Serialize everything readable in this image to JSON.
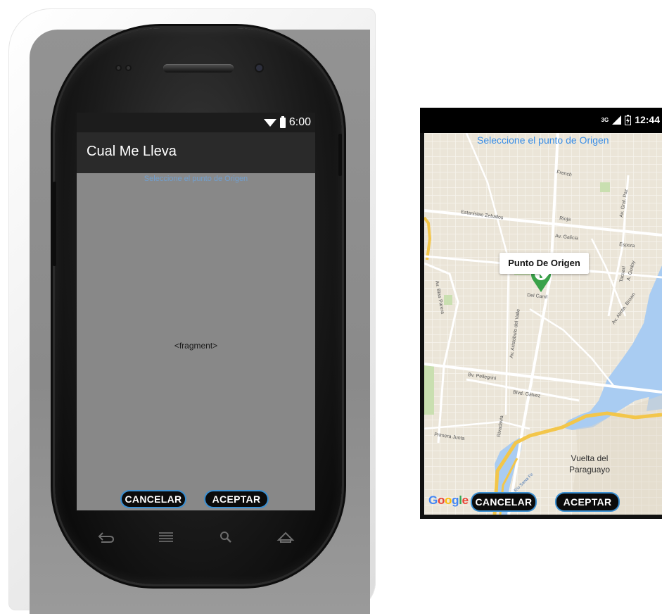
{
  "editor_preview": {
    "status_time": "6:00",
    "app_title": "Cual Me Lleva",
    "hint_text": "Seleccione el punto de Origen",
    "fragment_placeholder": "<fragment>",
    "cancel_label": "CANCELAR",
    "accept_label": "ACEPTAR",
    "nav_icons": [
      "back-icon",
      "menu-icon",
      "search-icon",
      "home-icon"
    ]
  },
  "device_screen": {
    "status_time": "12:44",
    "network": "3G",
    "prompt": "Seleccione el punto de Origen",
    "marker_title": "Punto De Origen",
    "cancel_label": "CANCELAR",
    "accept_label": "ACEPTAR",
    "map_brand": "Google",
    "map_labels": {
      "french": "French",
      "estanislao": "Estanislao Zeballos",
      "rioja": "Rioja",
      "galicia": "Av. Galicia",
      "espora": "Espora",
      "gral_paz": "Av. Gral. Paz",
      "blas_parera": "Av. Blas Parera",
      "tacuari": "Tacuarí",
      "godoy": "A. Godoy",
      "del_carril": "Del Carril",
      "aristobulo": "Av. Aristóbulo del Valle",
      "almte_brown": "Av. Almte. Brown",
      "pellegrini": "Bv. Pellegrini",
      "galvez": "Blvd. Gálvez",
      "rivadavia": "Rivadavia",
      "primera_junta": "Primera Junta",
      "rio_santa_fe": "Río Santa Fe",
      "vuelta_line1": "Vuelta del",
      "vuelta_line2": "Paraguayo"
    }
  }
}
